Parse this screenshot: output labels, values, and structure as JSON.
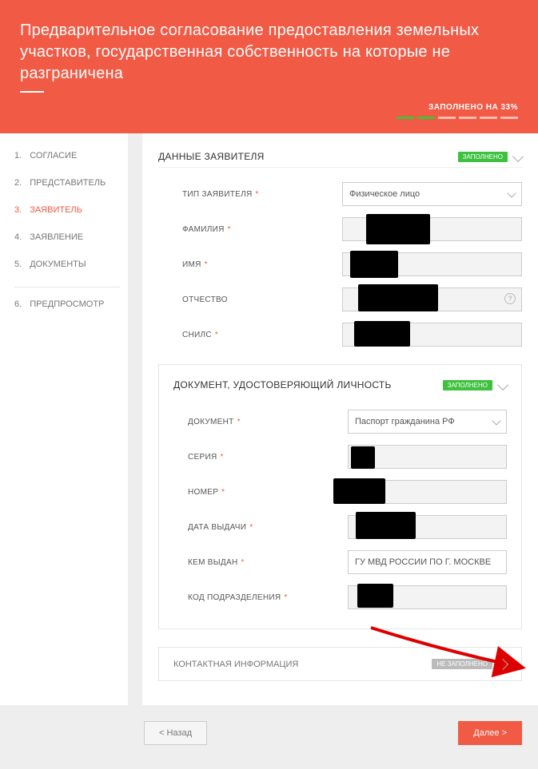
{
  "header": {
    "title": "Предварительное согласование предоставления земельных участков, государственная собственность на которые не разграничена",
    "progress_label": "ЗАПОЛНЕНО НА 33%"
  },
  "sidebar": {
    "items": [
      {
        "num": "1.",
        "label": "СОГЛАСИЕ"
      },
      {
        "num": "2.",
        "label": "ПРЕДСТАВИТЕЛЬ"
      },
      {
        "num": "3.",
        "label": "ЗАЯВИТЕЛЬ"
      },
      {
        "num": "4.",
        "label": "ЗАЯВЛЕНИЕ"
      },
      {
        "num": "5.",
        "label": "ДОКУМЕНТЫ"
      },
      {
        "num": "6.",
        "label": "ПРЕДПРОСМОТР"
      }
    ]
  },
  "section1": {
    "title": "ДАННЫЕ ЗАЯВИТЕЛЯ",
    "badge": "ЗАПОЛНЕНО",
    "fields": {
      "type_label": "ТИП ЗАЯВИТЕЛЯ",
      "type_value": "Физическое лицо",
      "lastname_label": "ФАМИЛИЯ",
      "firstname_label": "ИМЯ",
      "middlename_label": "ОТЧЕСТВО",
      "snils_label": "СНИЛС"
    }
  },
  "section2": {
    "title": "ДОКУМЕНТ, УДОСТОВЕРЯЮЩИЙ ЛИЧНОСТЬ",
    "badge": "ЗАПОЛНЕНО",
    "fields": {
      "doc_label": "ДОКУМЕНТ",
      "doc_value": "Паспорт гражданина РФ",
      "series_label": "СЕРИЯ",
      "number_label": "НОМЕР",
      "issue_date_label": "ДАТА ВЫДАЧИ",
      "issued_by_label": "КЕМ ВЫДАН",
      "issued_by_value": "ГУ МВД РОССИИ ПО Г. МОСКВЕ",
      "dept_code_label": "КОД ПОДРАЗДЕЛЕНИЯ"
    }
  },
  "section3": {
    "title": "КОНТАКТНАЯ ИНФОРМАЦИЯ",
    "badge": "НЕ ЗАПОЛНЕНО"
  },
  "footer": {
    "back": "< Назад",
    "next": "Далее >"
  }
}
